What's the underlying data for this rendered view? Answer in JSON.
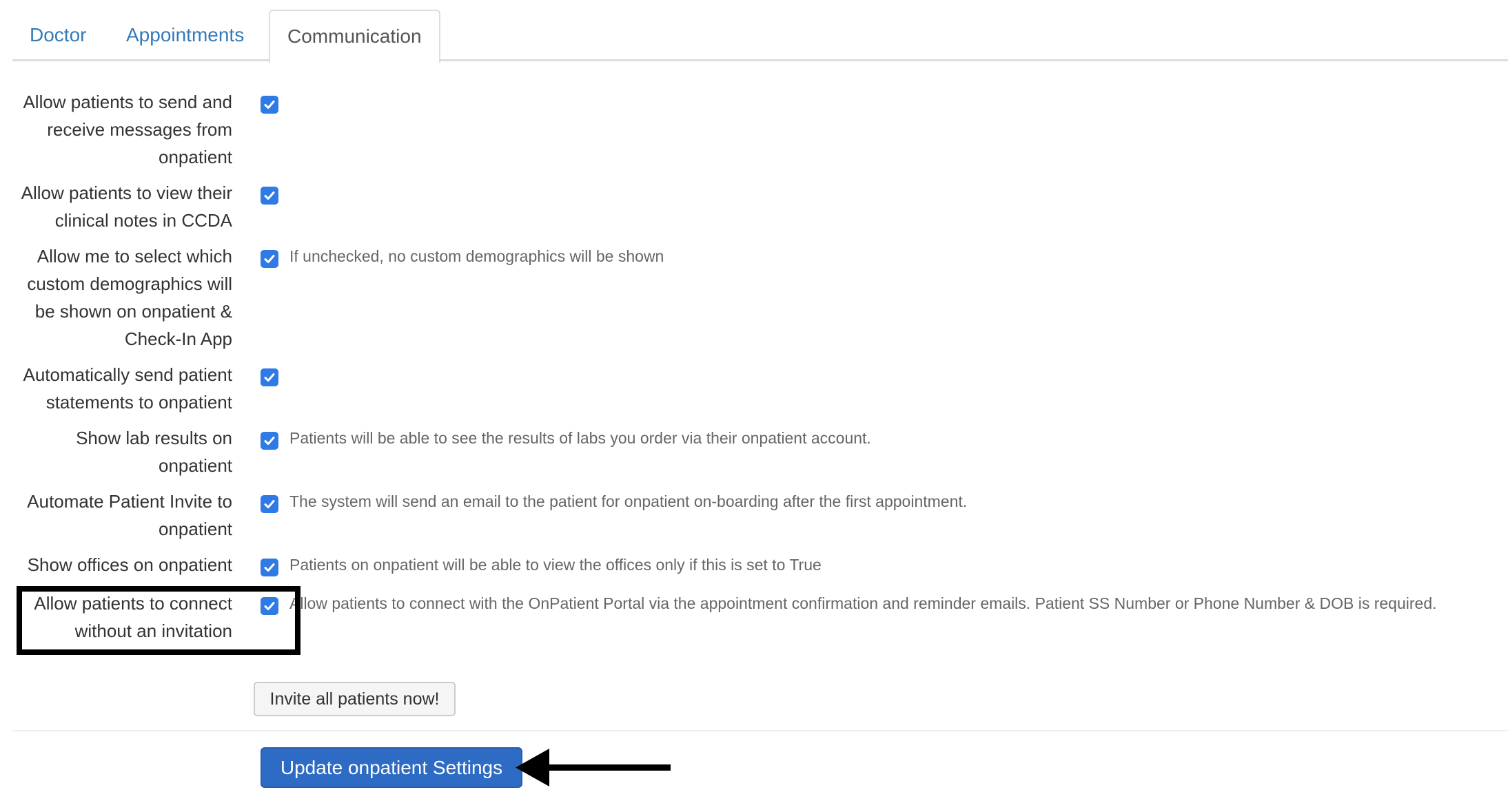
{
  "tabs": [
    {
      "label": "Doctor",
      "active": false
    },
    {
      "label": "Appointments",
      "active": false
    },
    {
      "label": "Communication",
      "active": true
    }
  ],
  "settings": [
    {
      "label": "Allow patients to send and receive messages from onpatient",
      "checked": true,
      "help": ""
    },
    {
      "label": "Allow patients to view their clinical notes in CCDA",
      "checked": true,
      "help": ""
    },
    {
      "label": "Allow me to select which custom demographics will be shown on onpatient & Check-In App",
      "checked": true,
      "help": "If unchecked, no custom demographics will be shown"
    },
    {
      "label": "Automatically send patient statements to onpatient",
      "checked": true,
      "help": ""
    },
    {
      "label": "Show lab results on onpatient",
      "checked": true,
      "help": "Patients will be able to see the results of labs you order via their onpatient account."
    },
    {
      "label": "Automate Patient Invite to onpatient",
      "checked": true,
      "help": "The system will send an email to the patient for onpatient on-boarding after the first appointment."
    },
    {
      "label": "Show offices on onpatient",
      "checked": true,
      "help": "Patients on onpatient will be able to view the offices only if this is set to True"
    },
    {
      "label": "Allow patients to connect without an invitation",
      "checked": true,
      "help": "Allow patients to connect with the OnPatient Portal via the appointment confirmation and reminder emails. Patient SS Number or Phone Number & DOB is required."
    }
  ],
  "buttons": {
    "invite_all": "Invite all patients now!",
    "update_settings": "Update onpatient Settings"
  },
  "annotations": {
    "highlight_target": "Allow patients to connect without an invitation",
    "arrow_target": "Update onpatient Settings"
  },
  "colors": {
    "link": "#337ab7",
    "checkbox": "#2f7ae5",
    "primary_button": "#2e6bc4",
    "annotation": "#000000"
  }
}
